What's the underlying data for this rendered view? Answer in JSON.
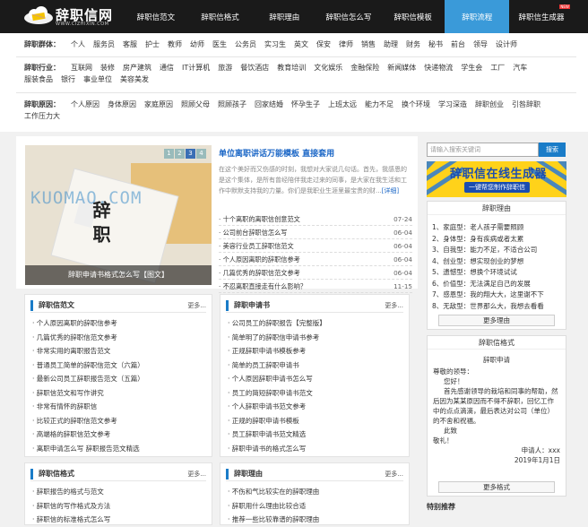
{
  "nav": {
    "logo_title": "辞职信网",
    "logo_sub": "WWW.CIZHIXIN.COM",
    "items": [
      {
        "label": "辞职信范文",
        "active": false
      },
      {
        "label": "辞职信格式",
        "active": false
      },
      {
        "label": "辞职理由",
        "active": false
      },
      {
        "label": "辞职信怎么写",
        "active": false
      },
      {
        "label": "辞职信模板",
        "active": false
      },
      {
        "label": "辞职流程",
        "active": true
      },
      {
        "label": "辞职信生成器",
        "active": false,
        "badge": "NEW"
      }
    ]
  },
  "filters": {
    "row1": {
      "label": "辞职群体：",
      "items": [
        "个人",
        "服务员",
        "客服",
        "护士",
        "教师",
        "幼师",
        "医生",
        "公务员",
        "实习生",
        "英文",
        "保安",
        "律师",
        "销售",
        "助理",
        "财务",
        "秘书",
        "前台",
        "领导",
        "设计师"
      ]
    },
    "row2": {
      "label": "辞职行业：",
      "items": [
        "互联网",
        "装修",
        "房产建筑",
        "通信",
        "IT计算机",
        "旅游",
        "餐饮酒店",
        "教育培训",
        "文化娱乐",
        "金融保险",
        "新闻媒体",
        "快递物流",
        "学生会",
        "工厂",
        "汽车",
        "服装食品",
        "银行",
        "事业单位",
        "美容美发"
      ]
    },
    "row3": {
      "label": "辞职原因：",
      "items": [
        "个人原因",
        "身体原因",
        "家庭原因",
        "照顾父母",
        "照顾孩子",
        "回家结婚",
        "怀孕生子",
        "上班太远",
        "能力不足",
        "换个环境",
        "学习深造",
        "辞职创业",
        "引咎辞职",
        "工作压力大"
      ]
    }
  },
  "slider": {
    "pages": [
      "1",
      "2",
      "3",
      "4"
    ],
    "active_page": "3",
    "watermark": "KUOMAO.COM",
    "paper_text": "辞 职",
    "caption": "辞职申请书格式怎么写【图文】"
  },
  "featured": {
    "title": "单位离职讲话万能模板 直接套用",
    "desc": "在这个美好而又伤感的时刻，我想对大家说几句话。首先，我感恩的是这个集体，是所有曾经陪伴我走过来的同事，是大家在我生活和工作中默默支持我的力量。你们是我职业生涯里最宝贵的财...",
    "more": "[详细]",
    "list": [
      {
        "title": "十个离职的离职信创意范文",
        "date": "07-24"
      },
      {
        "title": "公司前台辞职信怎么写",
        "date": "06-04"
      },
      {
        "title": "美容行业员工辞职信范文",
        "date": "06-04"
      },
      {
        "title": "个人原因离职的辞职信参考",
        "date": "06-04"
      },
      {
        "title": "几篇优秀的辞职信范文参考",
        "date": "06-04"
      },
      {
        "title": "不忍离职直接走有什么影响？",
        "date": "11-15"
      }
    ]
  },
  "sidebar": {
    "search_placeholder": "请输入搜索关键词",
    "search_button": "搜索",
    "banner_title": "辞职信在线生成器",
    "banner_sub": "一键帮您制作辞职信",
    "reasons": {
      "title": "辞职理由",
      "items": [
        "1、家庭型：老人孩子需要照顾",
        "2、身体型：身有疾病或者太累",
        "3、自我型：能力不足，不适合公司",
        "4、创业型：想实现创业的梦想",
        "5、遗憾型：想换个环境试试",
        "6、价值型：无法满足自己的发展",
        "7、感恩型：我的翔大大，这里谢不下",
        "8、无敌型：世界那么大，我想去看看"
      ],
      "more": "更多理由"
    },
    "format": {
      "title": "辞职信格式",
      "heading": "辞职申请",
      "salutation": "尊敬的领导：",
      "greeting": "您好！",
      "body": "首先感谢领导的栽培和同事的帮助，然后因为某某原因而不得不辞职，回忆工作中的点点滴滴，最后表达对公司（单位）的不舍和祝福。",
      "close1": "此致",
      "close2": "敬礼！",
      "signer": "申请人：xxx",
      "date": "2019年1月1日",
      "more": "更多格式"
    },
    "special": "特别推荐"
  },
  "columns": [
    {
      "name": "辞职信范文",
      "more": "更多...",
      "items": [
        "个人原因离职的辞职信参考",
        "几篇优秀的辞职信范文参考",
        "非常实用的离职报告范文",
        "普通员工简单的辞职信范文（六篇）",
        "最新公司员工辞职报告范文（五篇）",
        "辞职信范文和写作讲究",
        "非常有情怀的辞职信",
        "比较正式的辞职信范文参考",
        "高端格的辞职信范文参考",
        "离职申请怎么写 辞职报告范文精选"
      ]
    },
    {
      "name": "辞职申请书",
      "more": "更多...",
      "items": [
        "公司员工的辞职报告【完整版】",
        "简单明了的辞职信申请书参考",
        "正规辞职申请书模板参考",
        "简单的员工辞职申请书",
        "个人原因辞职申请书怎么写",
        "员工的简短辞职申请书范文",
        "个人辞职申请书范文参考",
        "正规的辞职申请书模板",
        "员工辞职申请书范文精选",
        "辞职申请书的格式怎么写"
      ]
    },
    {
      "name": "辞职信格式",
      "more": "更多...",
      "items": [
        "辞职报告的格式与范文",
        "辞职信的写作格式及方法",
        "辞职信的标准格式怎么写"
      ]
    },
    {
      "name": "辞职理由",
      "more": "更多...",
      "items": [
        "不伤和气比较实在的辞职理由",
        "辞职用什么理由比较合适",
        "推荐一些比较靠谱的辞职理由"
      ]
    }
  ]
}
